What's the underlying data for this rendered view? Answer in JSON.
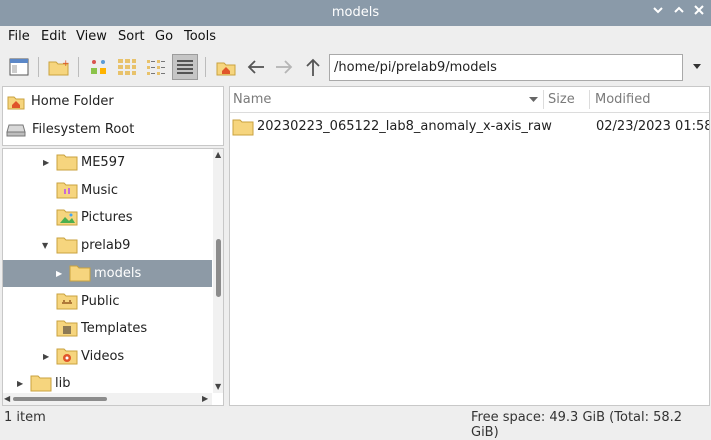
{
  "window": {
    "title": "models"
  },
  "menubar": {
    "items": [
      "File",
      "Edit",
      "View",
      "Sort",
      "Go",
      "Tools"
    ]
  },
  "location": {
    "path": "/home/pi/prelab9/models"
  },
  "places": [
    {
      "label": "Home Folder",
      "icon": "home-icon"
    },
    {
      "label": "Filesystem Root",
      "icon": "drive-icon"
    }
  ],
  "tree": [
    {
      "label": "ME597",
      "icon": "folder-icon"
    },
    {
      "label": "Music",
      "icon": "music-folder-icon"
    },
    {
      "label": "Pictures",
      "icon": "pictures-folder-icon"
    },
    {
      "label": "prelab9",
      "icon": "folder-icon"
    },
    {
      "label": "models",
      "icon": "folder-icon",
      "selected": true
    },
    {
      "label": "Public",
      "icon": "public-folder-icon"
    },
    {
      "label": "Templates",
      "icon": "templates-folder-icon"
    },
    {
      "label": "Videos",
      "icon": "videos-folder-icon"
    },
    {
      "label": "lib",
      "icon": "folder-icon"
    }
  ],
  "columns": {
    "name": "Name",
    "size": "Size",
    "modified": "Modified"
  },
  "files": [
    {
      "name": "20230223_065122_lab8_anomaly_x-axis_raw",
      "size": "",
      "modified": "02/23/2023 01:58"
    }
  ],
  "status": {
    "count": "1 item",
    "free": "Free space: 49.3 GiB (Total: 58.2 GiB)"
  },
  "colors": {
    "titlebar": "#8a9aa9",
    "selection": "#8d9aa6",
    "folder": "#f6d57e",
    "home_accent": "#e0552a"
  }
}
